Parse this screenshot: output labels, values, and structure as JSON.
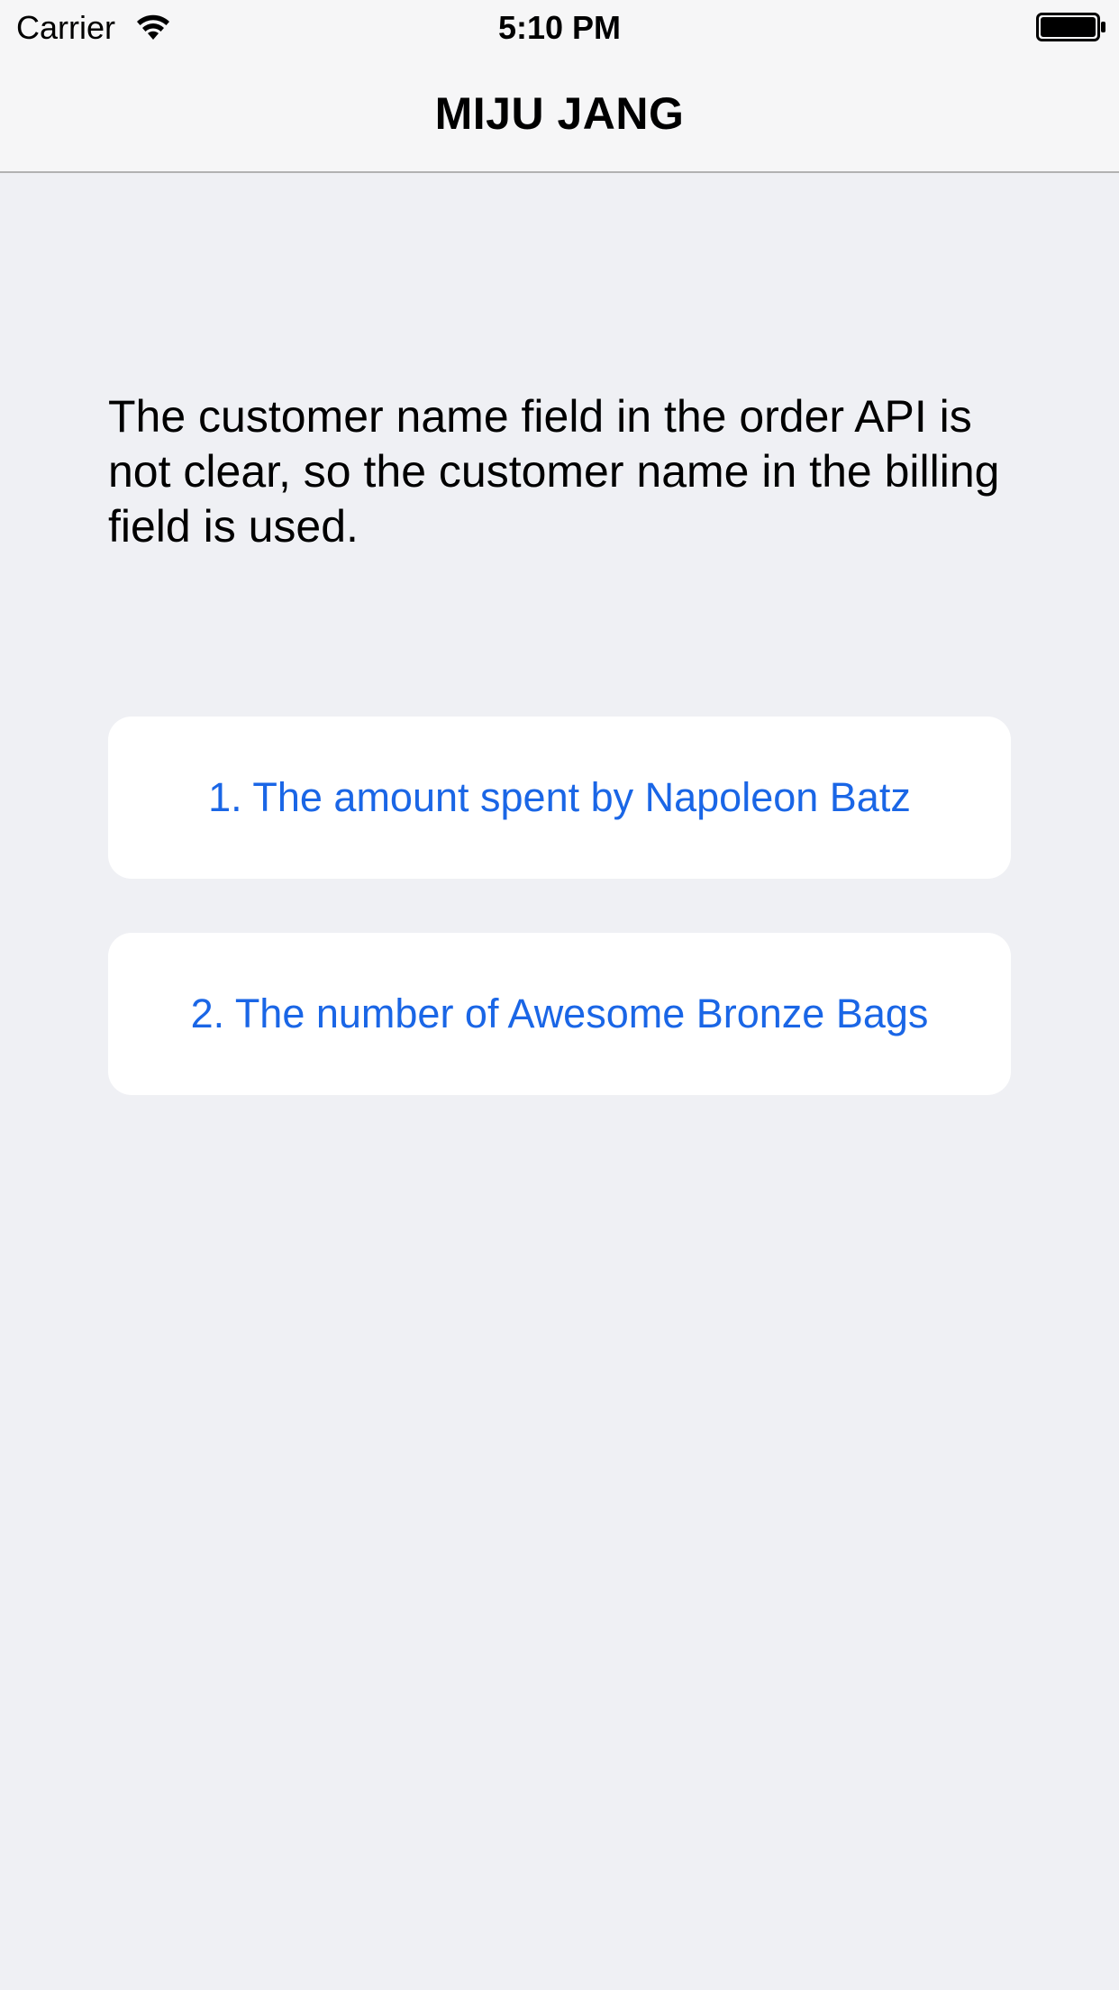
{
  "status_bar": {
    "carrier": "Carrier",
    "time": "5:10 PM",
    "icons": [
      "wifi-icon",
      "battery-icon"
    ]
  },
  "nav_bar": {
    "title": "MIJU JANG"
  },
  "content": {
    "description": "The customer name field in the order API is not clear, so the customer name in the billing field is used.",
    "options": [
      {
        "label": "1. The amount spent by Napoleon Batz"
      },
      {
        "label": "2. The number of Awesome Bronze Bags"
      }
    ]
  },
  "colors": {
    "background": "#EFF0F4",
    "bar_background": "#F6F6F7",
    "accent": "#1A66E6",
    "card": "#FFFFFF"
  }
}
